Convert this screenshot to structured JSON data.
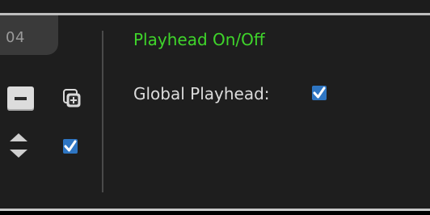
{
  "track": {
    "number": "04"
  },
  "panel": {
    "title": "Playhead On/Off",
    "global_playhead_label": "Global Playhead:",
    "global_playhead_checked": true
  },
  "controls": {
    "track_checkbox_checked": true
  },
  "colors": {
    "title": "#3fd52b",
    "checkbox": "#2e75c2",
    "background": "#1e1e1e"
  },
  "icons": {
    "remove": "minus-icon",
    "add_layer": "add-layer-icon",
    "reorder": "sort-arrows-icon",
    "check": "checkmark-icon"
  }
}
